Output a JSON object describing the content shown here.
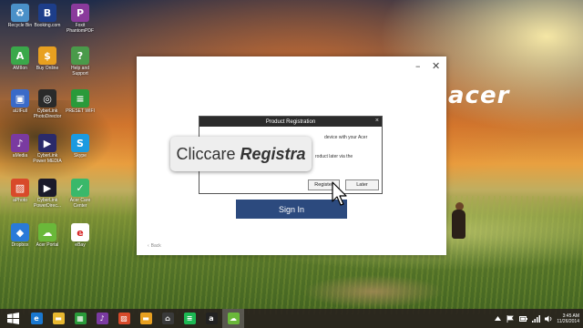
{
  "desktop": {
    "brand": "acer",
    "icons": [
      {
        "label": "Recycle Bin",
        "icon": "recycle-bin-icon",
        "color": "#4a90c8",
        "glyph": "♻"
      },
      {
        "label": "Booking.com",
        "icon": "booking-icon",
        "color": "#1d3e8a",
        "glyph": "B"
      },
      {
        "label": "Foxit PhantomPDF",
        "icon": "pdf-icon",
        "color": "#8a3a9c",
        "glyph": "P"
      },
      {
        "label": "AMIIon",
        "icon": "green-app-icon",
        "color": "#3aa84a",
        "glyph": "A"
      },
      {
        "label": "Buy Online",
        "icon": "buy-online-icon",
        "color": "#e8a020",
        "glyph": "$"
      },
      {
        "label": "Help and Support",
        "icon": "help-icon",
        "color": "#4a9a4a",
        "glyph": "?"
      },
      {
        "label": "aUIFull",
        "icon": "network-icon",
        "color": "#3a6ac8",
        "glyph": "▣"
      },
      {
        "label": "CyberLink PhotoDirector",
        "icon": "photodirector-icon",
        "color": "#2a2a2a",
        "glyph": "◎"
      },
      {
        "label": "PRESET WIFI",
        "icon": "wifi-icon",
        "color": "#2a9a3a",
        "glyph": "≡"
      },
      {
        "label": "aMedia",
        "icon": "media-icon",
        "color": "#7a3aa0",
        "glyph": "♪"
      },
      {
        "label": "CyberLink Power MEDIA",
        "icon": "powermedia-icon",
        "color": "#2a2a6a",
        "glyph": "▶"
      },
      {
        "label": "Skype",
        "icon": "skype-icon",
        "color": "#1a9ae0",
        "glyph": "S"
      },
      {
        "label": "aPhoto",
        "icon": "photo-icon",
        "color": "#d84a2a",
        "glyph": "▨"
      },
      {
        "label": "CyberLink PowerDirec...",
        "icon": "powerdirector-icon",
        "color": "#1a1a2a",
        "glyph": "▶"
      },
      {
        "label": "Acer Care Center",
        "icon": "care-center-icon",
        "color": "#3ab86a",
        "glyph": "✓"
      },
      {
        "label": "Dropbox",
        "icon": "dropbox-icon",
        "color": "#2a7ad8",
        "glyph": "◆"
      },
      {
        "label": "Acer Portal",
        "icon": "portal-icon",
        "color": "#6ab83a",
        "glyph": "☁"
      },
      {
        "label": "eBay",
        "icon": "ebay-icon",
        "color": "#ffffff",
        "glyph": "e"
      }
    ]
  },
  "installer": {
    "sign_in_label": "Sign In",
    "back_label": "Back"
  },
  "registration_dialog": {
    "title": "Product Registration",
    "line1": "device with your Acer",
    "line2": "roduct later via the",
    "register_label": "Register",
    "later_label": "Later"
  },
  "caption": {
    "verb": "Cliccare",
    "target": "Registra"
  },
  "taskbar": {
    "items": [
      {
        "name": "internet-explorer-icon",
        "color": "#1a78d0",
        "glyph": "e"
      },
      {
        "name": "file-explorer-icon",
        "color": "#e8b830",
        "glyph": "▬"
      },
      {
        "name": "store-icon",
        "color": "#2a9a3a",
        "glyph": "▦"
      },
      {
        "name": "media-app-icon",
        "color": "#7a3aa0",
        "glyph": "♪"
      },
      {
        "name": "photo-app-icon",
        "color": "#d84a2a",
        "glyph": "▨"
      },
      {
        "name": "folder-icon",
        "color": "#e8a020",
        "glyph": "▬"
      },
      {
        "name": "home-icon",
        "color": "#3a3a3a",
        "glyph": "⌂"
      },
      {
        "name": "spotify-icon",
        "color": "#1db954",
        "glyph": "≡"
      },
      {
        "name": "amazon-icon",
        "color": "#222222",
        "glyph": "a"
      },
      {
        "name": "acer-portal-task-icon",
        "color": "#6ab83a",
        "glyph": "☁"
      }
    ],
    "clock_time": "3:45 AM",
    "clock_date": "11/26/2014"
  }
}
